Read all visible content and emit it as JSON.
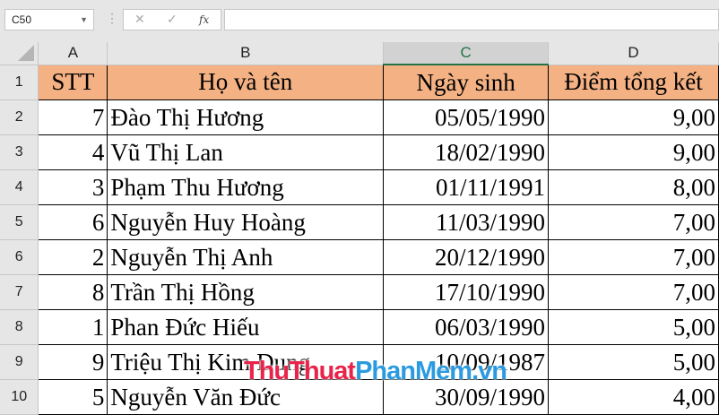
{
  "name_box": "C50",
  "formula_buttons": {
    "cancel": "✕",
    "enter": "✓",
    "fx": "fx"
  },
  "formula_value": "",
  "columns": [
    "A",
    "B",
    "C",
    "D"
  ],
  "header": {
    "stt": "STT",
    "name": "Họ và tên",
    "dob": "Ngày sinh",
    "score": "Điểm tổng kết"
  },
  "rows": [
    {
      "n": "2",
      "stt": "7",
      "name": "Đào Thị Hương",
      "dob": "05/05/1990",
      "score": "9,00"
    },
    {
      "n": "3",
      "stt": "4",
      "name": "Vũ Thị Lan",
      "dob": "18/02/1990",
      "score": "9,00"
    },
    {
      "n": "4",
      "stt": "3",
      "name": "Phạm Thu Hương",
      "dob": "01/11/1991",
      "score": "8,00"
    },
    {
      "n": "5",
      "stt": "6",
      "name": "Nguyễn Huy Hoàng",
      "dob": "11/03/1990",
      "score": "7,00"
    },
    {
      "n": "6",
      "stt": "2",
      "name": "Nguyễn Thị Anh",
      "dob": "20/12/1990",
      "score": "7,00"
    },
    {
      "n": "7",
      "stt": "8",
      "name": "Trần Thị Hồng",
      "dob": "17/10/1990",
      "score": "7,00"
    },
    {
      "n": "8",
      "stt": "1",
      "name": "Phan Đức Hiếu",
      "dob": "06/03/1990",
      "score": "5,00"
    },
    {
      "n": "9",
      "stt": "9",
      "name": "Triệu Thị Kim Dung",
      "dob": "10/09/1987",
      "score": "5,00"
    },
    {
      "n": "10",
      "stt": "5",
      "name": "Nguyễn Văn Đức",
      "dob": "30/09/1990",
      "score": "4,00"
    }
  ],
  "header_row_num": "1",
  "watermark": {
    "part1": "ThuThuat",
    "part2": "PhanMem",
    "part3": ".vn"
  },
  "colors": {
    "header_fill": "#f4b183",
    "accent": "#217346",
    "wm1": "#e8244a",
    "wm2": "#2b9be0"
  }
}
